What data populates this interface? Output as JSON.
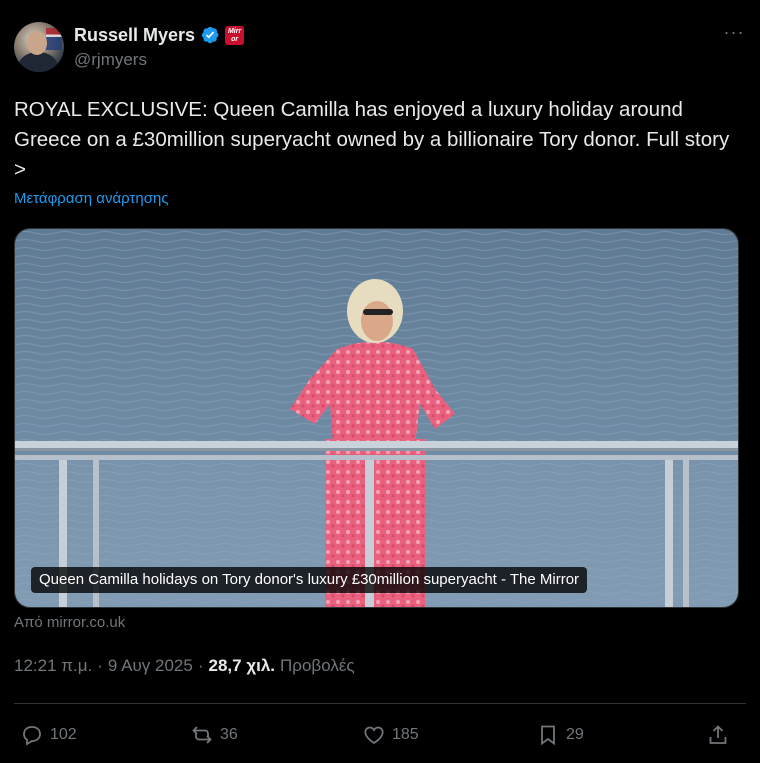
{
  "author": {
    "display_name": "Russell Myers",
    "handle": "@rjmyers",
    "affiliation_badge": "Mirror"
  },
  "tweet": {
    "text": "ROYAL EXCLUSIVE: Queen Camilla has enjoyed a luxury holiday around Greece on a £30million superyacht owned by a billionaire Tory donor. Full story >",
    "translate_label": "Μετάφραση ανάρτησης"
  },
  "link_card": {
    "caption": "Queen Camilla holidays on Tory donor's luxury £30million superyacht - The Mirror",
    "source": "Από mirror.co.uk"
  },
  "meta": {
    "time": "12:21 π.μ.",
    "date": "9 Αυγ 2025",
    "views_count": "28,7 χιλ.",
    "views_label": "Προβολές"
  },
  "actions": {
    "replies": "102",
    "reposts": "36",
    "likes": "185",
    "bookmarks": "29"
  },
  "icons": [
    "verified-icon",
    "more-icon",
    "reply-icon",
    "repost-icon",
    "like-icon",
    "bookmark-icon",
    "share-icon"
  ],
  "colors": {
    "background": "#000000",
    "text": "#e7e9ea",
    "muted": "#71767b",
    "link": "#1d9bf0",
    "verified": "#1d9bf0",
    "mirror_red": "#c8102e"
  }
}
